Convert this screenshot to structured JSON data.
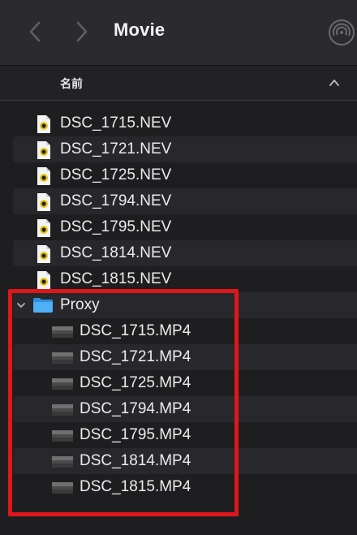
{
  "window": {
    "title": "Movie"
  },
  "toolbar": {
    "back_icon": "chevron-left-icon",
    "forward_icon": "chevron-right-icon",
    "airdrop_icon": "airdrop-icon"
  },
  "column_header": {
    "name_label": "名前",
    "sort_icon": "chevron-up-icon"
  },
  "files": [
    {
      "name": "DSC_1715.NEV",
      "icon": "raw-image-file-icon"
    },
    {
      "name": "DSC_1721.NEV",
      "icon": "raw-image-file-icon"
    },
    {
      "name": "DSC_1725.NEV",
      "icon": "raw-image-file-icon"
    },
    {
      "name": "DSC_1794.NEV",
      "icon": "raw-image-file-icon"
    },
    {
      "name": "DSC_1795.NEV",
      "icon": "raw-image-file-icon"
    },
    {
      "name": "DSC_1814.NEV",
      "icon": "raw-image-file-icon"
    },
    {
      "name": "DSC_1815.NEV",
      "icon": "raw-image-file-icon"
    }
  ],
  "folder": {
    "name": "Proxy",
    "expanded": true,
    "icon": "folder-icon",
    "disclosure_icon": "disclosure-down-icon",
    "children": [
      {
        "name": "DSC_1715.MP4",
        "icon": "video-thumbnail-icon"
      },
      {
        "name": "DSC_1721.MP4",
        "icon": "video-thumbnail-icon"
      },
      {
        "name": "DSC_1725.MP4",
        "icon": "video-thumbnail-icon"
      },
      {
        "name": "DSC_1794.MP4",
        "icon": "video-thumbnail-icon"
      },
      {
        "name": "DSC_1795.MP4",
        "icon": "video-thumbnail-icon"
      },
      {
        "name": "DSC_1814.MP4",
        "icon": "video-thumbnail-icon"
      },
      {
        "name": "DSC_1815.MP4",
        "icon": "video-thumbnail-icon"
      }
    ]
  },
  "colors": {
    "background": "#1e1e20",
    "toolbar": "#2b2a2e",
    "alternate_row": "#28272b",
    "folder_blue": "#3fa3f0",
    "highlight_red": "#e0161b"
  }
}
